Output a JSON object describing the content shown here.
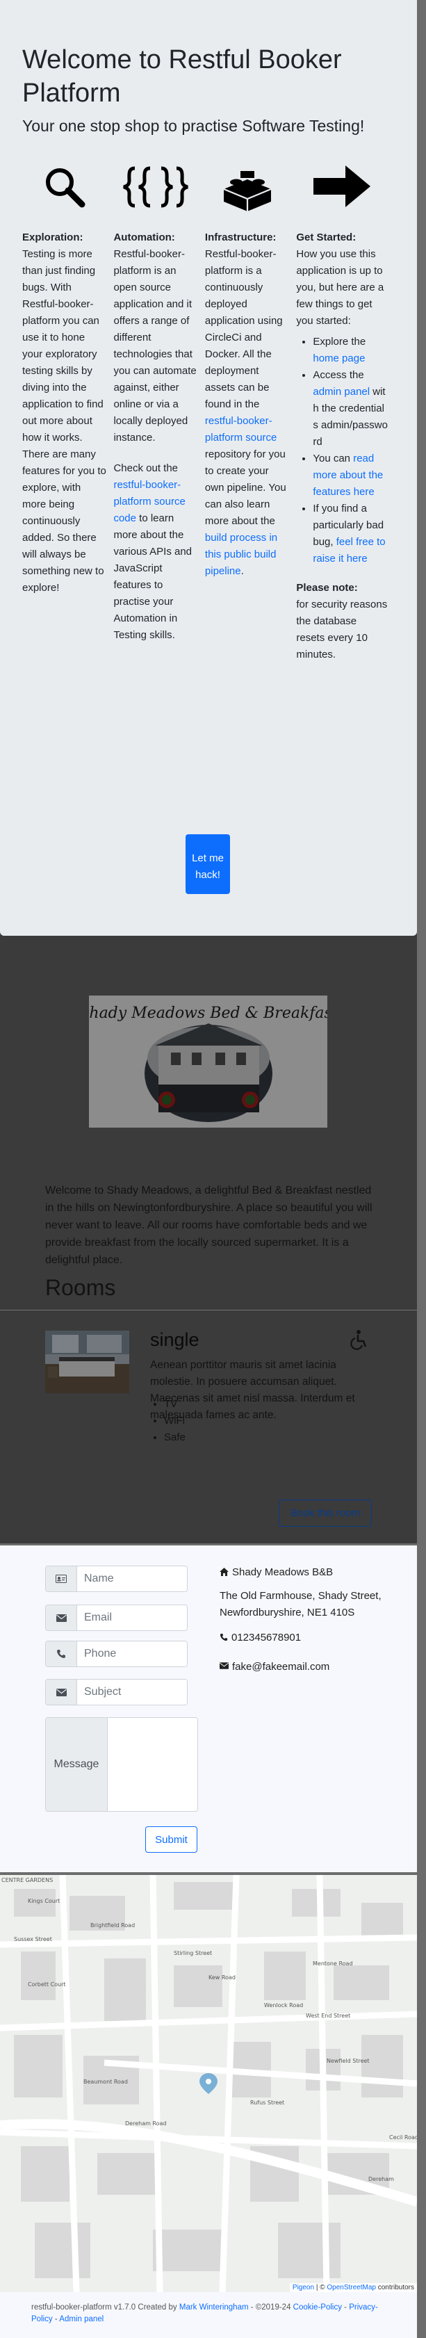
{
  "welcome": {
    "title": "Welcome to Restful Booker Platform",
    "subtitle": "Your one stop shop to practise Software Testing!",
    "exploration": {
      "heading": "Exploration:",
      "text": "Testing is more than just finding bugs. With Restful-booker-platform you can use it to hone your exploratory testing skills by diving into the application to find out more about how it works. There are many features for you to explore, with more being continuously added. So there will always be something new to explore!"
    },
    "automation": {
      "heading": "Automation:",
      "text": "Restful-booker-platform is an open source application and it offers a range of different technologies that you can automate against, either online or via a locally deployed instance.",
      "text2_pre": "Check out the ",
      "link": "restful-booker-platform source code",
      "text2_post": " to learn more about the various APIs and JavaScript features to practise your Automation in Testing skills."
    },
    "infrastructure": {
      "heading": "Infrastructure:",
      "text_pre": "Restful-booker-platform is a continuously deployed application using CircleCi and Docker. All the deployment assets can be found in the ",
      "link1": "restful-booker-platform source",
      "text_mid": " repository for you to create your own pipeline. You can also learn more about the ",
      "link2": "build process in this public build pipeline",
      "text_post": "."
    },
    "started": {
      "heading": "Get Started:",
      "intro": "How you use this application is up to you, but here are a few things to get you started:",
      "item1_pre": "Explore the ",
      "item1_link": "home page",
      "item2_pre": "Access the ",
      "item2_link": "admin panel",
      "item2_post": " with the credentials admin/password",
      "item3_pre": "You can ",
      "item3_link": "read more about the features here",
      "item4_pre": "If you find a particularly bad bug, ",
      "item4_link": "feel free to raise it here",
      "note_heading": "Please note:",
      "note": "for security reasons the database resets every 10 minutes."
    },
    "button": "Let me hack!"
  },
  "logo": {
    "text": "Shady Meadows Bed & Breakfast"
  },
  "description": "Welcome to Shady Meadows, a delightful Bed & Breakfast nestled in the hills on Newingtonfordburyshire. A place so beautiful you will never want to leave. All our rooms have comfortable beds and we provide breakfast from the locally sourced supermarket. It is a delightful place.",
  "rooms": {
    "heading": "Rooms",
    "items": [
      {
        "name": "single",
        "description": "Aenean porttitor mauris sit amet lacinia molestie. In posuere accumsan aliquet. Maecenas sit amet nisl massa. Interdum et malesuada fames ac ante.",
        "features": [
          "TV",
          "WiFi",
          "Safe"
        ],
        "book_label": "Book this room"
      }
    ]
  },
  "contact": {
    "name_placeholder": "Name",
    "email_placeholder": "Email",
    "phone_placeholder": "Phone",
    "subject_placeholder": "Subject",
    "message_label": "Message",
    "submit": "Submit",
    "business_name": "Shady Meadows B&B",
    "address": "The Old Farmhouse, Shady Street, Newfordburyshire, NE1 410S",
    "phone": "012345678901",
    "email": "fake@fakeemail.com"
  },
  "map": {
    "labels": [
      "CENTRE GARDENS",
      "Kings Court",
      "Brightfield Road",
      "Sussex Street",
      "Corbett Court",
      "Stirling Street",
      "Wenlock Road",
      "Kew Road",
      "West End Street",
      "Mentone Road",
      "Newfield Street",
      "Dereham Road",
      "Cecil Road",
      "Rufus Street",
      "Beaumont Road",
      "Dereham"
    ],
    "attribution_pigeon": "Pigeon",
    "attribution_sep": " | © ",
    "attribution_osm": "OpenStreetMap",
    "attribution_post": " contributors"
  },
  "footer": {
    "text": "restful-booker-platform v1.7.0 Created by ",
    "author": "Mark Winteringham",
    "year": " - ©2019-24 ",
    "cookie": "Cookie-Policy",
    "sep1": " - ",
    "privacy": "Privacy-Policy",
    "sep2": " - ",
    "admin": "Admin panel"
  },
  "colors": {
    "primary": "#0d6efd",
    "overlay": "#6c6c6c",
    "modal_bg": "#e9ecef"
  }
}
